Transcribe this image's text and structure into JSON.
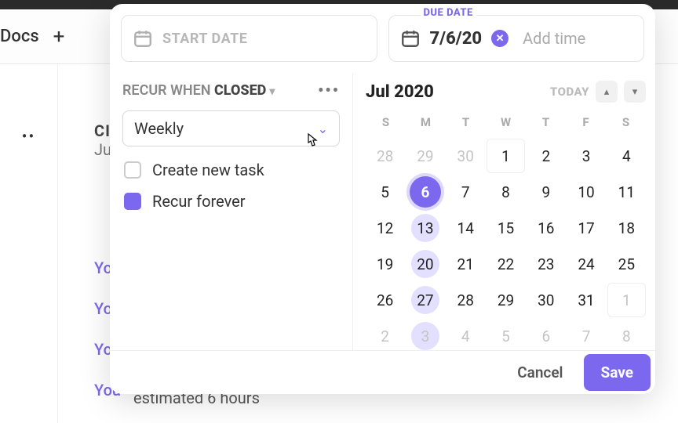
{
  "background": {
    "docs_label": "Docs",
    "plus": "+",
    "line_c": "CI",
    "line_j": "Ju",
    "links": [
      "Yo",
      "Yo",
      "Yo",
      "You"
    ],
    "estimated": "estimated 6 hours"
  },
  "date_inputs": {
    "start_placeholder": "START DATE",
    "due_label": "DUE DATE",
    "due_value": "7/6/20",
    "add_time": "Add time"
  },
  "recur": {
    "title_prefix": "RECUR WHEN ",
    "title_state": "CLOSED",
    "frequency": "Weekly",
    "create_new_label": "Create new task",
    "create_new_checked": false,
    "recur_forever_label": "Recur forever",
    "recur_forever_checked": true
  },
  "calendar": {
    "month_label": "Jul 2020",
    "today_label": "TODAY",
    "weekdays": [
      "S",
      "M",
      "T",
      "W",
      "T",
      "F",
      "S"
    ],
    "grid": [
      {
        "n": "28",
        "other": true
      },
      {
        "n": "29",
        "other": true
      },
      {
        "n": "30",
        "other": true
      },
      {
        "n": "1",
        "box": true
      },
      {
        "n": "2"
      },
      {
        "n": "3"
      },
      {
        "n": "4"
      },
      {
        "n": "5"
      },
      {
        "n": "6",
        "selected": true
      },
      {
        "n": "7"
      },
      {
        "n": "8"
      },
      {
        "n": "9"
      },
      {
        "n": "10"
      },
      {
        "n": "11"
      },
      {
        "n": "12"
      },
      {
        "n": "13",
        "hl": true
      },
      {
        "n": "14"
      },
      {
        "n": "15"
      },
      {
        "n": "16"
      },
      {
        "n": "17"
      },
      {
        "n": "18"
      },
      {
        "n": "19"
      },
      {
        "n": "20",
        "hl": true
      },
      {
        "n": "21"
      },
      {
        "n": "22"
      },
      {
        "n": "23"
      },
      {
        "n": "24"
      },
      {
        "n": "25"
      },
      {
        "n": "26"
      },
      {
        "n": "27",
        "hl": true
      },
      {
        "n": "28"
      },
      {
        "n": "29"
      },
      {
        "n": "30"
      },
      {
        "n": "31"
      },
      {
        "n": "1",
        "other": true,
        "box": true
      },
      {
        "n": "2",
        "other": true
      },
      {
        "n": "3",
        "other": true,
        "hl": true
      },
      {
        "n": "4",
        "other": true
      },
      {
        "n": "5",
        "other": true
      },
      {
        "n": "6",
        "other": true
      },
      {
        "n": "7",
        "other": true
      },
      {
        "n": "8",
        "other": true
      }
    ]
  },
  "footer": {
    "cancel": "Cancel",
    "save": "Save"
  },
  "colors": {
    "accent": "#7b68ee"
  }
}
